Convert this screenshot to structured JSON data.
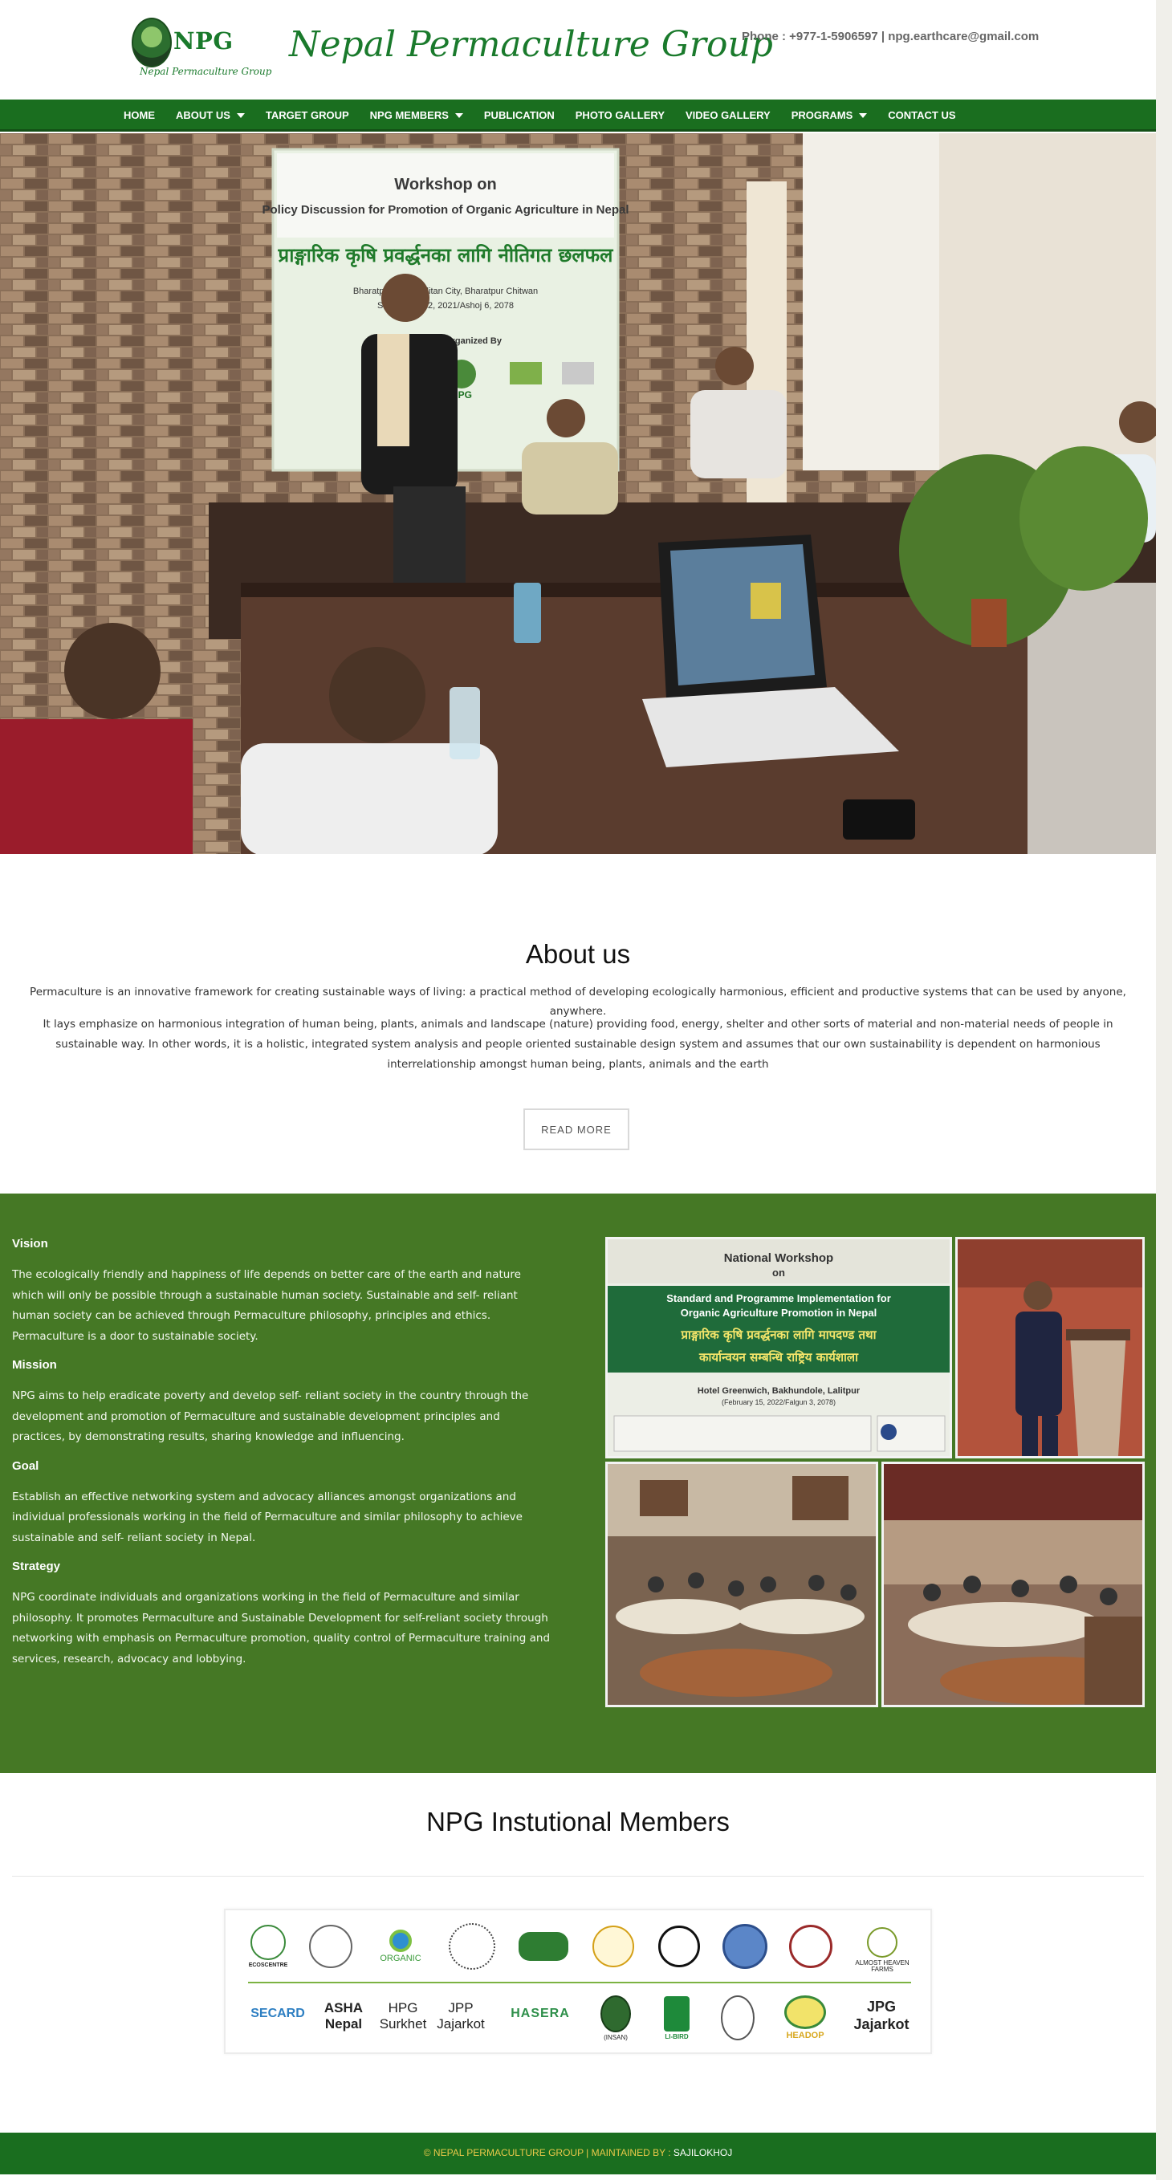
{
  "header": {
    "logo_text": "NPG",
    "logo_subtitle": "Nepal Permaculture Group",
    "site_title": "Nepal Permaculture Group",
    "contact": "Phone : +977-1-5906597 | npg.earthcare@gmail.com"
  },
  "nav": {
    "items": [
      {
        "label": "HOME",
        "dropdown": false
      },
      {
        "label": "ABOUT US",
        "dropdown": true
      },
      {
        "label": "TARGET GROUP",
        "dropdown": false
      },
      {
        "label": "NPG MEMBERS",
        "dropdown": true
      },
      {
        "label": "PUBLICATION",
        "dropdown": false
      },
      {
        "label": "PHOTO GALLERY",
        "dropdown": false
      },
      {
        "label": "VIDEO GALLERY",
        "dropdown": false
      },
      {
        "label": "PROGRAMS",
        "dropdown": true
      },
      {
        "label": "CONTACT US",
        "dropdown": false
      }
    ]
  },
  "hero": {
    "banner_title": "Workshop on",
    "banner_subtitle": "Policy Discussion for Promotion of Organic Agriculture in Nepal",
    "banner_nepali": "प्राङ्गारिक कृषि प्रवर्द्धनका लागि नीतिगत छलफल",
    "banner_place": "Bharatpur Metropolitan City, Bharatpur Chitwan",
    "banner_date": "September 22, 2021/Ashoj 6, 2078",
    "banner_org": "Supported & Organized By",
    "banner_logo": "NPG"
  },
  "about": {
    "title": "About us",
    "paragraph1": "Permaculture is an innovative framework for creating sustainable ways of living: a practical method of developing ecologically harmonious, efficient and productive systems that can be used by anyone, anywhere.",
    "paragraph2": "It lays emphasize on harmonious integration of human being, plants, animals and landscape (nature) providing food, energy, shelter and other sorts of material and non-material needs of people in sustainable way. In other words, it is a holistic, integrated system analysis and people oriented sustainable design system and assumes that our own sustainability is dependent on harmonious interrelationship amongst human being, plants, animals and the earth",
    "button": "READ MORE"
  },
  "values": {
    "vision_title": "Vision",
    "vision_text": "The ecologically friendly and happiness of life depends on better care of the earth and nature which will only be possible through a sustainable human society. Sustainable and self- reliant human society can be achieved through Permaculture philosophy, principles and ethics. Permaculture is a door to sustainable society.",
    "mission_title": "Mission",
    "mission_text": "NPG aims to help eradicate poverty and develop self- reliant society in the country through the development and promotion of Permaculture and sustainable development principles and practices, by demonstrating results, sharing knowledge and influencing.",
    "goal_title": "Goal",
    "goal_text": "Establish an effective networking system and advocacy alliances amongst organizations and individual professionals working in the field of Permaculture and similar philosophy to achieve sustainable and self- reliant society in Nepal.",
    "strategy_title": "Strategy",
    "strategy_text": "NPG coordinate individuals and organizations working in the field of Permaculture and similar philosophy. It promotes Permaculture and Sustainable Development for self-reliant society through networking with emphasis on Permaculture promotion, quality control of Permaculture training and services, research, advocacy and lobbying."
  },
  "gallery": {
    "poster_line1": "National Workshop",
    "poster_line2": "on",
    "poster_line3": "Standard and Programme Implementation for",
    "poster_line4": "Organic Agriculture Promotion in Nepal",
    "poster_nepali1": "प्राङ्गारिक कृषि प्रवर्द्धनका लागि मापदण्ड तथा",
    "poster_nepali2": "कार्यान्वयन सम्बन्धि राष्ट्रिय कार्यशाला",
    "poster_venue": "Hotel Greenwich, Bakhundole, Lalitpur",
    "poster_date": "(February 15, 2022/Falgun 3, 2078)"
  },
  "members": {
    "title": "NPG Instutional Members",
    "row1": [
      "ECOSCENTRE",
      "",
      "ORGANIC",
      "",
      "",
      "",
      "",
      "",
      "",
      "ALMOST HEAVEN FARMS"
    ],
    "row2": [
      "SECARD",
      "ASHA Nepal",
      "HPG Surkhet",
      "JPP Jajarkot",
      "HASERA",
      "(INSAN)",
      "LI-BIRD",
      "",
      "HEADOP",
      "JPG Jajarkot"
    ]
  },
  "footer": {
    "copyright": "© NEPAL PERMACULTURE GROUP | MAINTAINED BY : ",
    "maintainer": "SAJILOKHOJ"
  },
  "colors": {
    "brand_green": "#1a6e1f",
    "section_green": "#457825",
    "footer_text": "#e8c84a"
  }
}
